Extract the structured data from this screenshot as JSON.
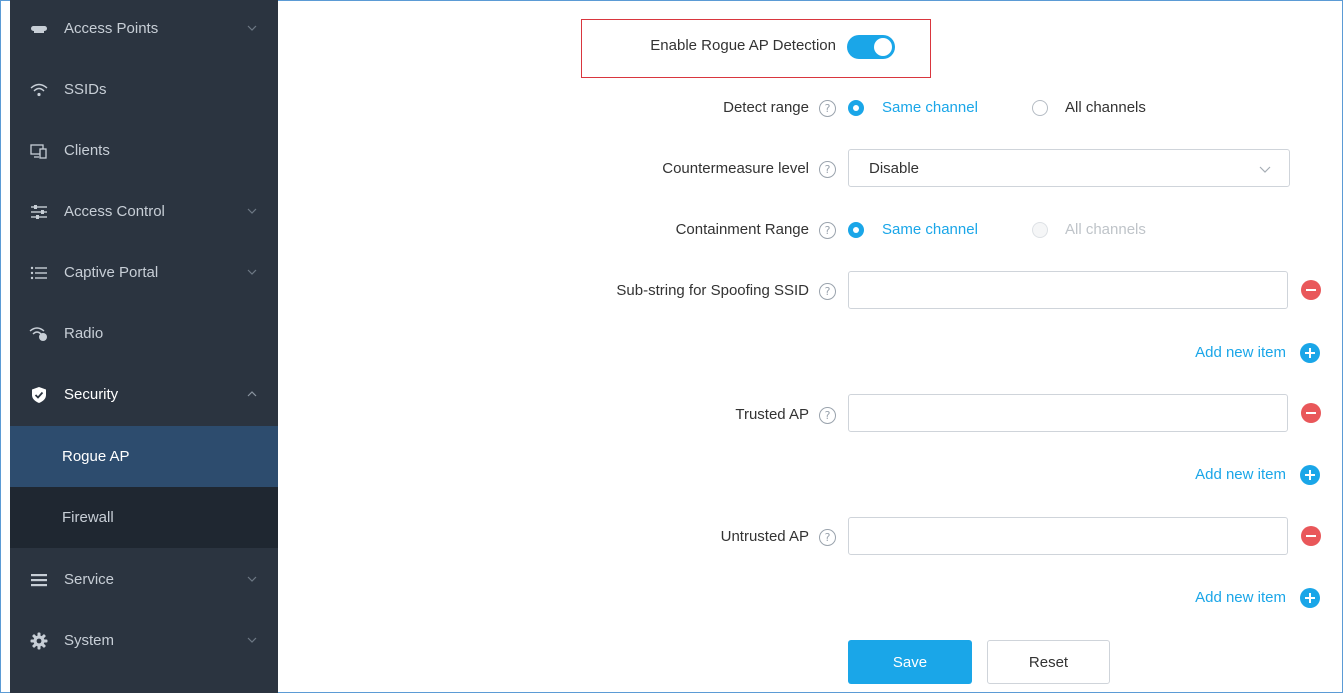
{
  "sidebar": {
    "items": [
      {
        "label": "Access Points",
        "icon": "access-point-icon",
        "expandable": true
      },
      {
        "label": "SSIDs",
        "icon": "wifi-icon",
        "expandable": false
      },
      {
        "label": "Clients",
        "icon": "devices-icon",
        "expandable": false
      },
      {
        "label": "Access Control",
        "icon": "filter-icon",
        "expandable": true
      },
      {
        "label": "Captive Portal",
        "icon": "list-icon",
        "expandable": true
      },
      {
        "label": "Radio",
        "icon": "radio-icon",
        "expandable": false
      },
      {
        "label": "Security",
        "icon": "shield-icon",
        "expandable": true,
        "expanded": true
      },
      {
        "label": "Service",
        "icon": "menu-icon",
        "expandable": true
      },
      {
        "label": "System",
        "icon": "gear-icon",
        "expandable": true
      }
    ],
    "security_subitems": [
      {
        "label": "Rogue AP",
        "active": true
      },
      {
        "label": "Firewall",
        "active": false
      }
    ]
  },
  "form": {
    "enable_rogue": {
      "label": "Enable Rogue AP Detection",
      "checked": true
    },
    "detect_range": {
      "label": "Detect range",
      "options": [
        "Same channel",
        "All channels"
      ],
      "selected": "Same channel"
    },
    "countermeasure": {
      "label": "Countermeasure level",
      "value": "Disable"
    },
    "containment_range": {
      "label": "Containment Range",
      "options": [
        "Same channel",
        "All channels"
      ],
      "selected": "Same channel",
      "disabled_option": "All channels"
    },
    "spoofing_ssid": {
      "label": "Sub-string for Spoofing SSID",
      "value": ""
    },
    "trusted_ap": {
      "label": "Trusted AP",
      "value": ""
    },
    "untrusted_ap": {
      "label": "Untrusted AP",
      "value": ""
    },
    "add_new_item": "Add new item",
    "help_glyph": "?"
  },
  "actions": {
    "save": "Save",
    "reset": "Reset"
  },
  "colors": {
    "accent": "#1aa6e8",
    "sidebar_bg": "#2b3440",
    "active_sub_bg": "#2d4c6e",
    "danger": "#e9575a",
    "highlight": "#d9363e"
  }
}
